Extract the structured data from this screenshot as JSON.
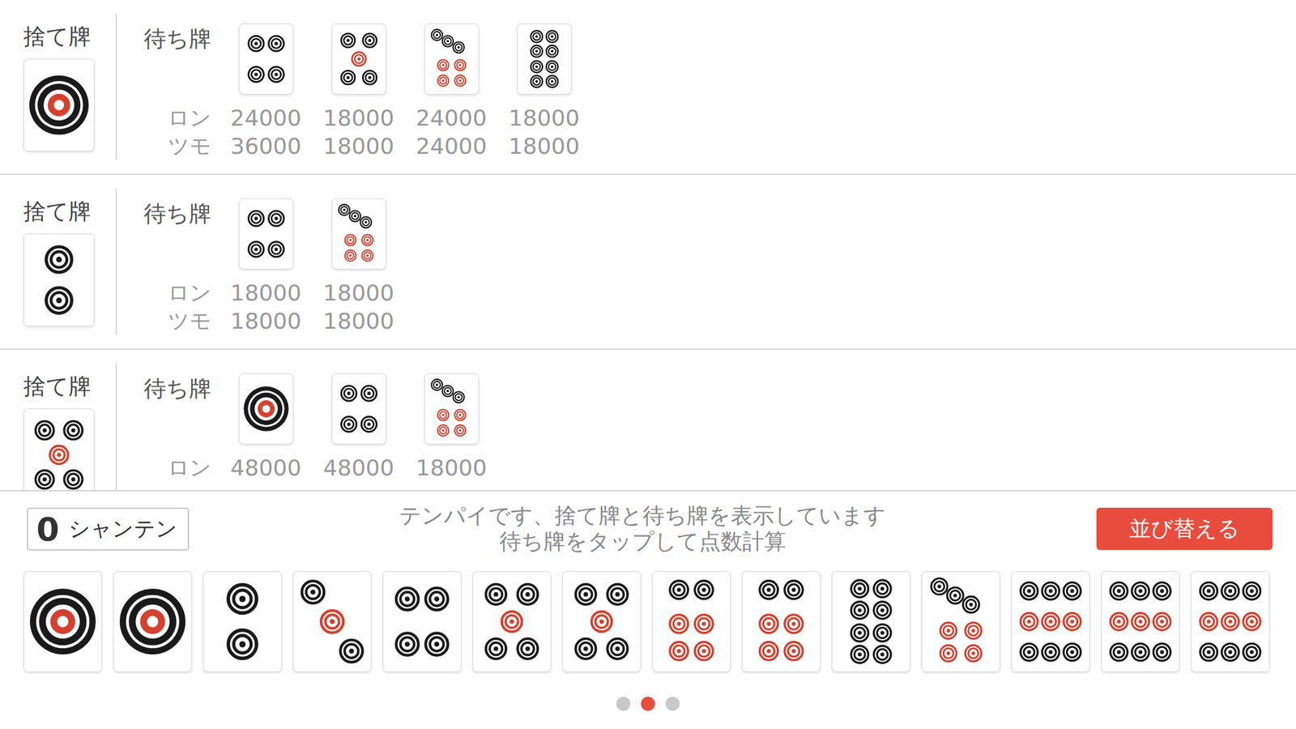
{
  "labels": {
    "discard": "捨て牌",
    "waits": "待ち牌",
    "ron": "ロン",
    "tsumo": "ツモ"
  },
  "discard_options": [
    {
      "discard": {
        "tile": "1p"
      },
      "waits": [
        {
          "tile": "4p",
          "ron": "24000",
          "tsumo": "36000"
        },
        {
          "tile": "5p",
          "ron": "18000",
          "tsumo": "18000"
        },
        {
          "tile": "7p",
          "ron": "24000",
          "tsumo": "24000"
        },
        {
          "tile": "8p",
          "ron": "18000",
          "tsumo": "18000"
        }
      ]
    },
    {
      "discard": {
        "tile": "2p"
      },
      "waits": [
        {
          "tile": "4p",
          "ron": "18000",
          "tsumo": "18000"
        },
        {
          "tile": "7p",
          "ron": "18000",
          "tsumo": "18000"
        }
      ]
    },
    {
      "discard": {
        "tile": "5p"
      },
      "waits": [
        {
          "tile": "1p",
          "ron": "48000"
        },
        {
          "tile": "4p",
          "ron": "48000"
        },
        {
          "tile": "7p",
          "ron": "18000"
        }
      ]
    }
  ],
  "shanten": {
    "count": "0",
    "label": "シャンテン"
  },
  "message": [
    "テンパイです、捨て牌と待ち牌を表示しています",
    "待ち牌をタップして点数計算"
  ],
  "sort_button": "並び替える",
  "hand": [
    {
      "tile": "1p"
    },
    {
      "tile": "1p"
    },
    {
      "tile": "2p"
    },
    {
      "tile": "3p"
    },
    {
      "tile": "4p"
    },
    {
      "tile": "5p"
    },
    {
      "tile": "5p"
    },
    {
      "tile": "6p"
    },
    {
      "tile": "6p"
    },
    {
      "tile": "8p"
    },
    {
      "tile": "7p"
    },
    {
      "tile": "9p"
    },
    {
      "tile": "9p"
    },
    {
      "tile": "9p"
    }
  ],
  "pages": [
    {
      "selected": false
    },
    {
      "selected": true
    },
    {
      "selected": false
    }
  ]
}
